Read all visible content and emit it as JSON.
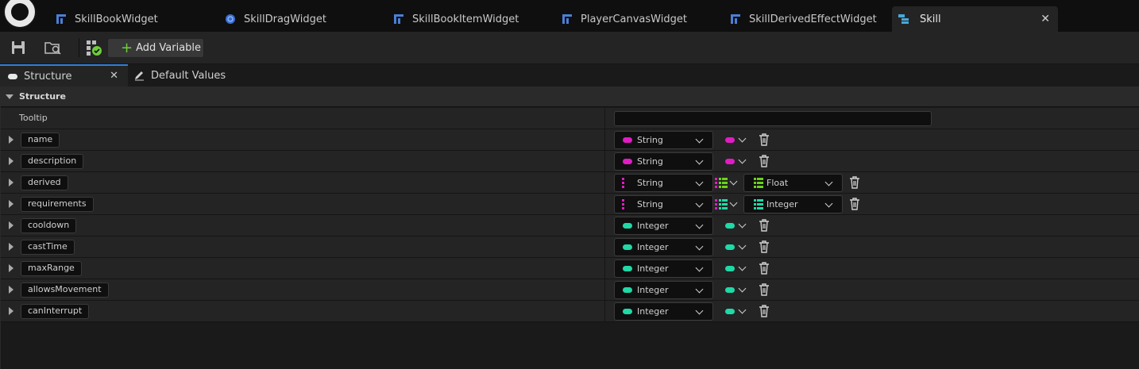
{
  "window_tabs": [
    {
      "label": "SkillBookWidget",
      "icon": "widget-blueprint-icon",
      "active": false
    },
    {
      "label": "SkillDragWidget",
      "icon": "blueprint-class-icon",
      "active": false
    },
    {
      "label": "SkillBookItemWidget",
      "icon": "widget-blueprint-icon",
      "active": false
    },
    {
      "label": "PlayerCanvasWidget",
      "icon": "widget-blueprint-icon",
      "active": false
    },
    {
      "label": "SkillDerivedEffectWidget",
      "icon": "widget-blueprint-icon",
      "active": false
    },
    {
      "label": "Skill",
      "icon": "structure-icon",
      "active": true
    }
  ],
  "toolbar": {
    "add_variable_label": "Add Variable"
  },
  "panel_tabs": {
    "structure_label": "Structure",
    "default_values_label": "Default Values"
  },
  "section": {
    "title": "Structure",
    "tooltip_label": "Tooltip",
    "tooltip_value": ""
  },
  "colors": {
    "string": "#e01cc4",
    "integer": "#1fd9a6",
    "float": "#6bd21a"
  },
  "variables": [
    {
      "name": "name",
      "type": "String",
      "container": "single"
    },
    {
      "name": "description",
      "type": "String",
      "container": "single"
    },
    {
      "name": "derived",
      "type": "String",
      "container": "map",
      "value_type": "Float"
    },
    {
      "name": "requirements",
      "type": "String",
      "container": "map",
      "value_type": "Integer"
    },
    {
      "name": "cooldown",
      "type": "Integer",
      "container": "single"
    },
    {
      "name": "castTime",
      "type": "Integer",
      "container": "single"
    },
    {
      "name": "maxRange",
      "type": "Integer",
      "container": "single"
    },
    {
      "name": "allowsMovement",
      "type": "Integer",
      "container": "single"
    },
    {
      "name": "canInterrupt",
      "type": "Integer",
      "container": "single"
    }
  ]
}
